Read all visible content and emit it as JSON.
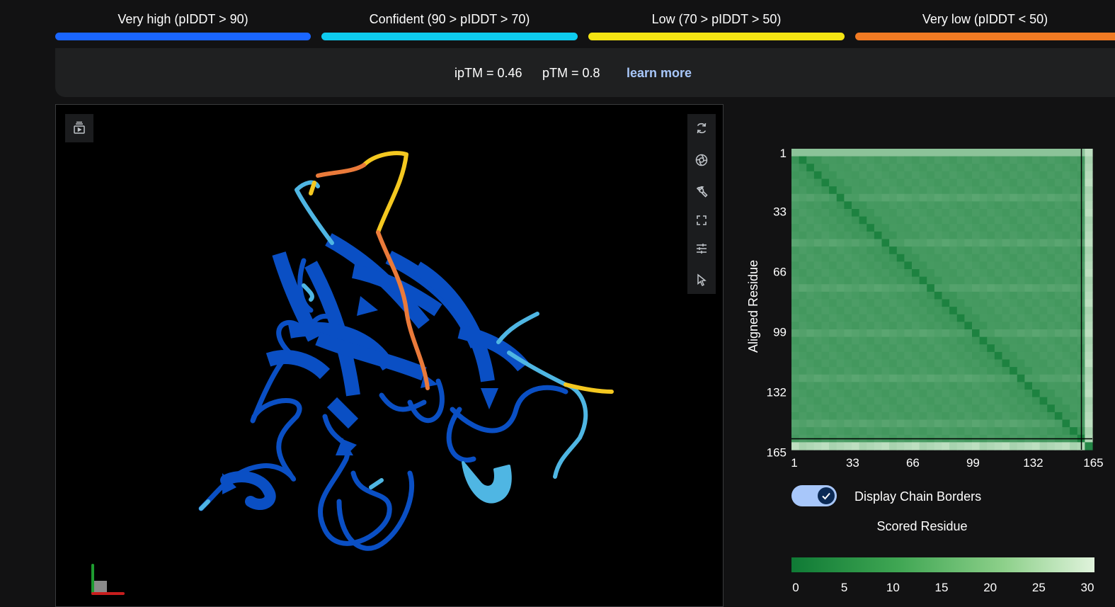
{
  "legend": [
    {
      "label": "Very high (pIDDT > 90)",
      "color": "#1a66ff"
    },
    {
      "label": "Confident (90 > pIDDT > 70)",
      "color": "#0ecbee"
    },
    {
      "label": "Low (70 > pIDDT > 50)",
      "color": "#f4e413"
    },
    {
      "label": "Very low (pIDDT < 50)",
      "color": "#f07a23"
    }
  ],
  "metrics": {
    "iptm": "ipTM = 0.46",
    "ptm": "pTM = 0.8",
    "learn_more": "learn more"
  },
  "viewer": {
    "left_tool_icon": "sequence-panel-icon",
    "right_tools": [
      "reset-view-icon",
      "screenshot-icon",
      "wrench-icon",
      "fullscreen-icon",
      "settings-sliders-icon",
      "select-cursor-icon"
    ]
  },
  "pae": {
    "ylabel": "Aligned Residue",
    "xlabel": "Scored Residue",
    "y_ticks": [
      "1",
      "33",
      "66",
      "99",
      "132",
      "165"
    ],
    "x_ticks": [
      "1",
      "33",
      "66",
      "99",
      "132",
      "165"
    ],
    "toggle_label": "Display Chain Borders",
    "toggle_on": true,
    "colorbar_ticks": [
      "0",
      "5",
      "10",
      "15",
      "20",
      "25",
      "30"
    ],
    "colors": {
      "low": "#0f7a35",
      "high": "#e0f3dc"
    }
  },
  "chart_data": {
    "type": "heatmap",
    "xlabel": "Scored Residue",
    "ylabel": "Aligned Residue",
    "x_ticks": [
      1,
      33,
      66,
      99,
      132,
      165
    ],
    "y_ticks": [
      1,
      33,
      66,
      99,
      132,
      165
    ],
    "x_range": [
      1,
      166
    ],
    "y_range": [
      1,
      166
    ],
    "chain_border": 160,
    "colorbar": {
      "min": 0,
      "max": 30,
      "ticks": [
        0,
        5,
        10,
        15,
        20,
        25,
        30
      ]
    },
    "description_values": {
      "diagonal": 0,
      "intra_chain_A": 5,
      "inter_chain": 22,
      "intra_chain_B": 3
    }
  }
}
